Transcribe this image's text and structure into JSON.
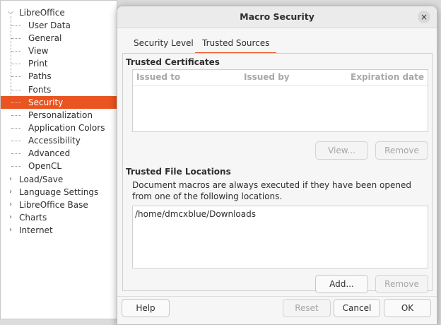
{
  "tree": {
    "root_label": "LibreOffice",
    "children": [
      "User Data",
      "General",
      "View",
      "Print",
      "Paths",
      "Fonts",
      "Security",
      "Personalization",
      "Application Colors",
      "Accessibility",
      "Advanced",
      "OpenCL"
    ],
    "selected": "Security",
    "top_items": [
      "Load/Save",
      "Language Settings",
      "LibreOffice Base",
      "Charts",
      "Internet"
    ]
  },
  "dialog": {
    "title": "Macro Security",
    "close_glyph": "×",
    "tabs": [
      "Security Level",
      "Trusted Sources"
    ],
    "active_tab": "Trusted Sources",
    "certificates": {
      "title": "Trusted Certificates",
      "columns": [
        "Issued to",
        "Issued by",
        "Expiration date"
      ],
      "rows": [],
      "view_label": "View...",
      "remove_label": "Remove"
    },
    "locations": {
      "title": "Trusted File Locations",
      "description": "Document macros are always executed if they have been opened from one of the following locations.",
      "items": [
        "/home/dmcxblue/Downloads"
      ],
      "add_label": "Add...",
      "remove_label": "Remove"
    },
    "footer": {
      "help_label": "Help",
      "reset_label": "Reset",
      "cancel_label": "Cancel",
      "ok_label": "OK"
    }
  },
  "colors": {
    "accent": "#e95420",
    "selection_text": "#ffffff",
    "disabled_text": "#a6a6a6"
  }
}
